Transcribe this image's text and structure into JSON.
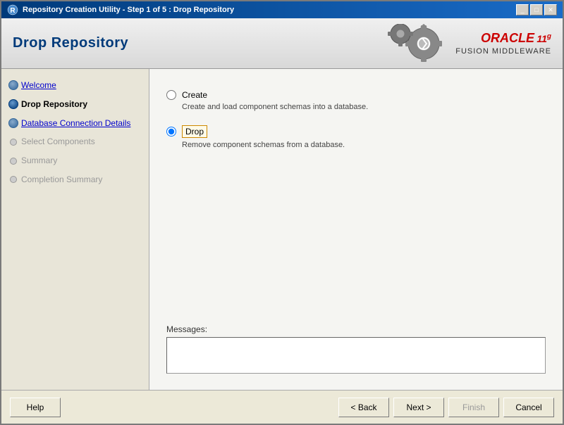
{
  "window": {
    "title": "Repository Creation Utility - Step 1 of 5 : Drop Repository",
    "minimize_label": "_",
    "maximize_label": "□",
    "close_label": "✕"
  },
  "header": {
    "title": "Drop Repository",
    "oracle_label": "ORACLE",
    "fusion_label": "FUSION MIDDLEWARE",
    "version": "11",
    "version_sup": "g"
  },
  "sidebar": {
    "items": [
      {
        "id": "welcome",
        "label": "Welcome",
        "state": "visited"
      },
      {
        "id": "drop-repository",
        "label": "Drop Repository",
        "state": "active"
      },
      {
        "id": "database-connection",
        "label": "Database Connection Details",
        "state": "visited"
      },
      {
        "id": "select-components",
        "label": "Select Components",
        "state": "inactive"
      },
      {
        "id": "summary",
        "label": "Summary",
        "state": "inactive"
      },
      {
        "id": "completion-summary",
        "label": "Completion Summary",
        "state": "inactive"
      }
    ]
  },
  "content": {
    "options": [
      {
        "id": "create",
        "label": "Create",
        "description": "Create and load component schemas into a database.",
        "selected": false
      },
      {
        "id": "drop",
        "label": "Drop",
        "description": "Remove component schemas from a database.",
        "selected": true
      }
    ]
  },
  "messages": {
    "label": "Messages:",
    "placeholder": ""
  },
  "footer": {
    "help_label": "Help",
    "back_label": "< Back",
    "next_label": "Next >",
    "finish_label": "Finish",
    "cancel_label": "Cancel"
  }
}
